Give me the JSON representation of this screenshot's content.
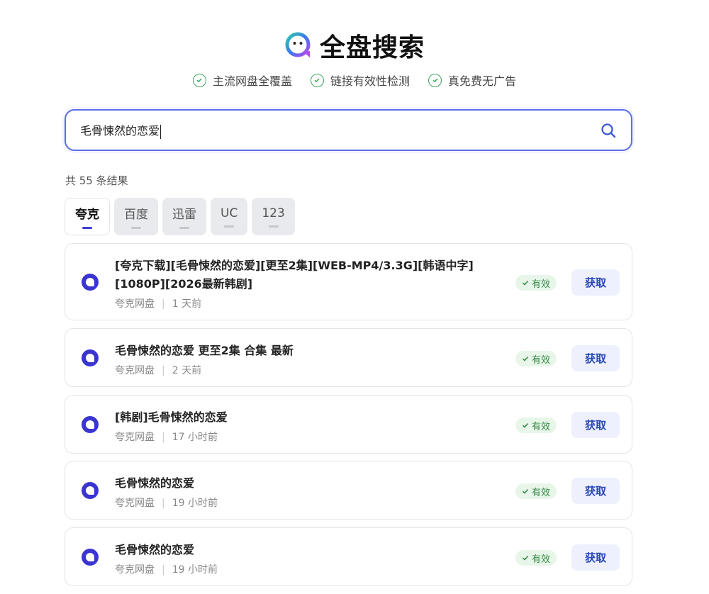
{
  "app": {
    "title": "全盘搜索"
  },
  "features": [
    "主流网盘全覆盖",
    "链接有效性检测",
    "真免费无广告"
  ],
  "search": {
    "value": "毛骨悚然的恋爱"
  },
  "result_count": "共 55 条结果",
  "tabs": [
    {
      "label": "夸克",
      "active": true
    },
    {
      "label": "百度",
      "active": false
    },
    {
      "label": "迅雷",
      "active": false
    },
    {
      "label": "UC",
      "active": false
    },
    {
      "label": "123",
      "active": false
    }
  ],
  "results": [
    {
      "title": "[夸克下载][毛骨悚然的恋爱][更至2集][WEB-MP4/3.3G][韩语中字][1080P][2026最新韩剧]",
      "source": "夸克网盘",
      "time": "1 天前",
      "status": "有效",
      "action": "获取"
    },
    {
      "title": "毛骨悚然的恋爱 更至2集 合集 最新",
      "source": "夸克网盘",
      "time": "2 天前",
      "status": "有效",
      "action": "获取"
    },
    {
      "title": "[韩剧]毛骨悚然的恋爱",
      "source": "夸克网盘",
      "time": "17 小时前",
      "status": "有效",
      "action": "获取"
    },
    {
      "title": "毛骨悚然的恋爱",
      "source": "夸克网盘",
      "time": "19 小时前",
      "status": "有效",
      "action": "获取"
    },
    {
      "title": "毛骨悚然的恋爱",
      "source": "夸克网盘",
      "time": "19 小时前",
      "status": "有效",
      "action": "获取"
    }
  ],
  "icons": {
    "logo": "chat-bubble-logo-icon",
    "search": "search-icon",
    "check": "check-icon",
    "source": "quark-icon"
  },
  "colors": {
    "accent": "#5b6ee6",
    "active_tab": "#3d3fd6",
    "valid_bg": "#e8f6ea",
    "valid_text": "#2e8a40",
    "button_bg": "#eef1fd",
    "button_text": "#2a49b8"
  }
}
